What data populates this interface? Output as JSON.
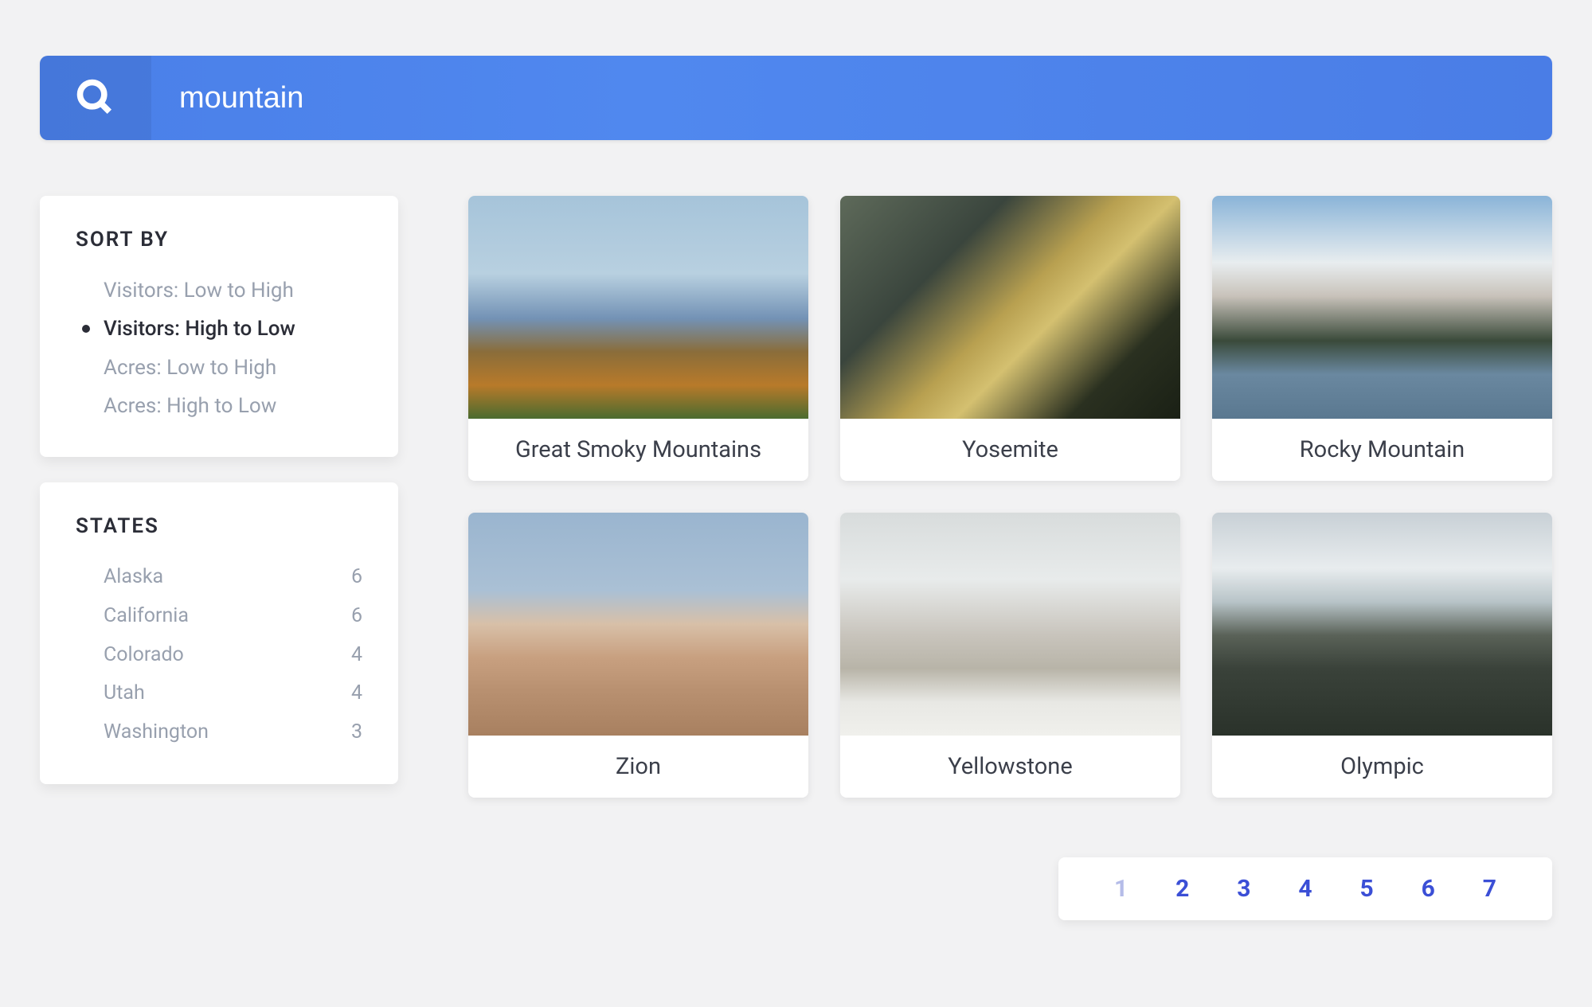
{
  "search": {
    "value": "mountain",
    "placeholder": "Search..."
  },
  "sidebar": {
    "sort": {
      "title": "SORT BY",
      "options": [
        {
          "label": "Visitors: Low to High",
          "active": false
        },
        {
          "label": "Visitors: High to Low",
          "active": true
        },
        {
          "label": "Acres: Low to High",
          "active": false
        },
        {
          "label": "Acres: High to Low",
          "active": false
        }
      ]
    },
    "states": {
      "title": "STATES",
      "items": [
        {
          "name": "Alaska",
          "count": "6"
        },
        {
          "name": "California",
          "count": "6"
        },
        {
          "name": "Colorado",
          "count": "4"
        },
        {
          "name": "Utah",
          "count": "4"
        },
        {
          "name": "Washington",
          "count": "3"
        }
      ]
    }
  },
  "results": {
    "cards": [
      {
        "title": "Great Smoky Mountains"
      },
      {
        "title": "Yosemite"
      },
      {
        "title": "Rocky Mountain"
      },
      {
        "title": "Zion"
      },
      {
        "title": "Yellowstone"
      },
      {
        "title": "Olympic"
      }
    ]
  },
  "pagination": {
    "pages": [
      "1",
      "2",
      "3",
      "4",
      "5",
      "6",
      "7"
    ],
    "current": "1"
  }
}
